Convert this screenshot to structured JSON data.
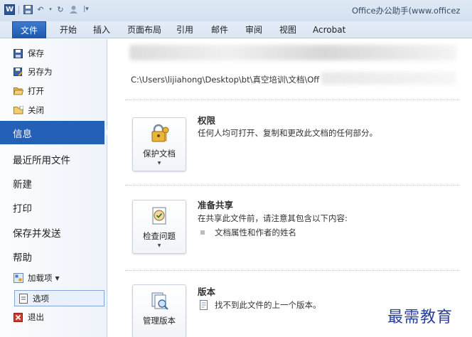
{
  "titlebar": {
    "app_logo": "W",
    "window_title": "Office办公助手(www.officez"
  },
  "tabs": [
    {
      "label": "文件",
      "active": true
    },
    {
      "label": "开始"
    },
    {
      "label": "插入"
    },
    {
      "label": "页面布局"
    },
    {
      "label": "引用"
    },
    {
      "label": "邮件"
    },
    {
      "label": "审阅"
    },
    {
      "label": "视图"
    },
    {
      "label": "Acrobat"
    }
  ],
  "nav": {
    "save": "保存",
    "save_as": "另存为",
    "open": "打开",
    "close": "关闭",
    "info": "信息",
    "recent": "最近所用文件",
    "new": "新建",
    "print": "打印",
    "save_send": "保存并发送",
    "help": "帮助",
    "addins": "加载项",
    "options": "选项",
    "exit": "退出"
  },
  "info": {
    "path": "C:\\Users\\lijiahong\\Desktop\\bt\\真空培训\\文档\\Off",
    "permissions": {
      "button_label": "保护文档",
      "title": "权限",
      "description": "任何人均可打开、复制和更改此文档的任何部分。"
    },
    "prepare": {
      "button_label": "检查问题",
      "title": "准备共享",
      "description": "在共享此文件前，请注意其包含以下内容:",
      "items": [
        "文档属性和作者的姓名"
      ]
    },
    "versions": {
      "button_label": "管理版本",
      "title": "版本",
      "description": "找不到此文件的上一个版本。"
    }
  },
  "watermark": "最需教育",
  "colors": {
    "file_tab": "#2461b6",
    "nav_active": "#2461b6",
    "watermark": "#2a3f9a"
  }
}
